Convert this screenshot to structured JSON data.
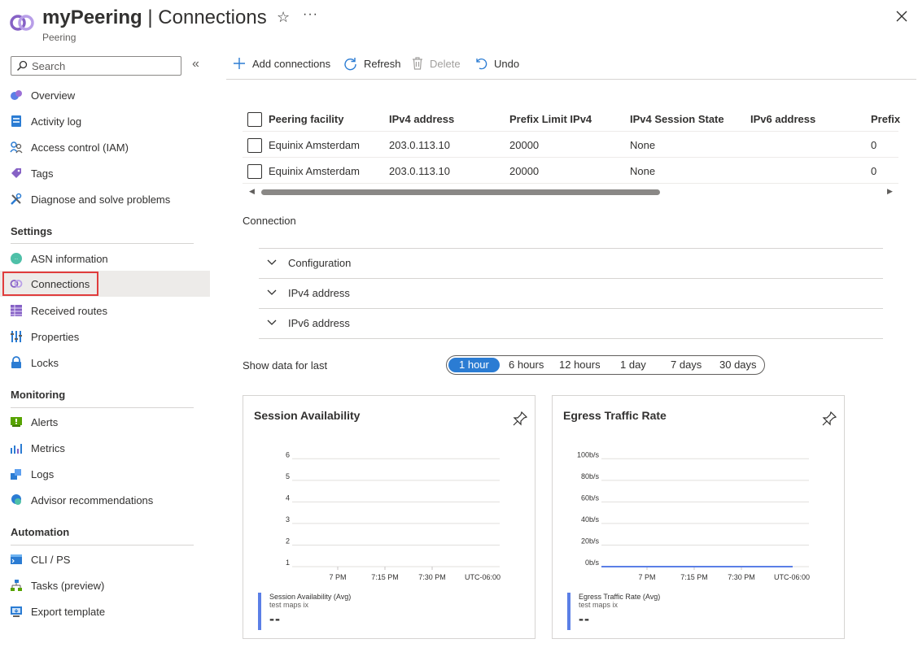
{
  "header": {
    "title_bold": "myPeering",
    "title_rest": " | Connections",
    "subtitle": "Peering",
    "favorite_icon": "star-icon",
    "more_icon": "more-icon",
    "close_icon": "close-icon"
  },
  "sidebar": {
    "search_placeholder": "Search",
    "collapse_icon": "collapse-icon",
    "items": [
      {
        "label": "Overview",
        "icon": "overview-icon"
      },
      {
        "label": "Activity log",
        "icon": "activity-log-icon"
      },
      {
        "label": "Access control (IAM)",
        "icon": "iam-icon"
      },
      {
        "label": "Tags",
        "icon": "tag-icon"
      },
      {
        "label": "Diagnose and solve problems",
        "icon": "diagnose-icon"
      }
    ],
    "settings_title": "Settings",
    "settings_items": [
      {
        "label": "ASN information",
        "icon": "asn-icon"
      },
      {
        "label": "Connections",
        "icon": "connections-icon"
      },
      {
        "label": "Received routes",
        "icon": "routes-icon"
      },
      {
        "label": "Properties",
        "icon": "properties-icon"
      },
      {
        "label": "Locks",
        "icon": "lock-icon"
      }
    ],
    "monitoring_title": "Monitoring",
    "monitoring_items": [
      {
        "label": "Alerts",
        "icon": "alerts-icon"
      },
      {
        "label": "Metrics",
        "icon": "metrics-icon"
      },
      {
        "label": "Logs",
        "icon": "logs-icon"
      },
      {
        "label": "Advisor recommendations",
        "icon": "advisor-icon"
      }
    ],
    "automation_title": "Automation",
    "automation_items": [
      {
        "label": "CLI / PS",
        "icon": "cli-icon"
      },
      {
        "label": "Tasks (preview)",
        "icon": "tasks-icon"
      },
      {
        "label": "Export template",
        "icon": "export-icon"
      }
    ]
  },
  "toolbar": {
    "add": "Add connections",
    "refresh": "Refresh",
    "delete": "Delete",
    "undo": "Undo"
  },
  "table": {
    "columns": [
      "Peering facility",
      "IPv4 address",
      "Prefix Limit IPv4",
      "IPv4 Session State",
      "IPv6 address",
      "Prefix"
    ],
    "rows": [
      [
        "Equinix Amsterdam",
        "203.0.113.10",
        "20000",
        "None",
        "",
        "0"
      ],
      [
        "Equinix Amsterdam",
        "203.0.113.10",
        "20000",
        "None",
        "",
        "0"
      ]
    ]
  },
  "connection": {
    "label": "Connection",
    "sections": [
      "Configuration",
      "IPv4 address",
      "IPv6 address"
    ]
  },
  "timerange": {
    "label": "Show data for last",
    "options": [
      "1 hour",
      "6 hours",
      "12 hours",
      "1 day",
      "7 days",
      "30 days"
    ],
    "selected": "1 hour"
  },
  "charts": [
    {
      "title": "Session Availability",
      "legend_name": "Session Availability (Avg)",
      "legend_sub": "test maps ix",
      "legend_value": "--"
    },
    {
      "title": "Egress Traffic Rate",
      "legend_name": "Egress Traffic Rate (Avg)",
      "legend_sub": "test maps ix",
      "legend_value": "--"
    }
  ],
  "chart_data": [
    {
      "type": "line",
      "title": "Session Availability",
      "xlabel": "",
      "ylabel": "",
      "x_ticks": [
        "7 PM",
        "7:15 PM",
        "7:30 PM",
        "UTC-06:00"
      ],
      "y_ticks": [
        "1",
        "2",
        "3",
        "4",
        "5",
        "6"
      ],
      "ylim": [
        1,
        6
      ],
      "series": [
        {
          "name": "Session Availability (Avg)",
          "values": []
        }
      ],
      "grid": true,
      "legend": "bottom-left"
    },
    {
      "type": "line",
      "title": "Egress Traffic Rate",
      "xlabel": "",
      "ylabel": "",
      "x_ticks": [
        "7 PM",
        "7:15 PM",
        "7:30 PM",
        "UTC-06:00"
      ],
      "y_ticks": [
        "0b/s",
        "20b/s",
        "40b/s",
        "60b/s",
        "80b/s",
        "100b/s"
      ],
      "ylim": [
        0,
        100
      ],
      "series": [
        {
          "name": "Egress Traffic Rate (Avg)",
          "values": [
            0,
            0
          ],
          "color": "#5b7fe6"
        }
      ],
      "grid": true,
      "legend": "bottom-left"
    }
  ],
  "colors": {
    "accent": "#2b7cd3",
    "series": "#5b7fe6",
    "highlight": "#e03c3c"
  }
}
